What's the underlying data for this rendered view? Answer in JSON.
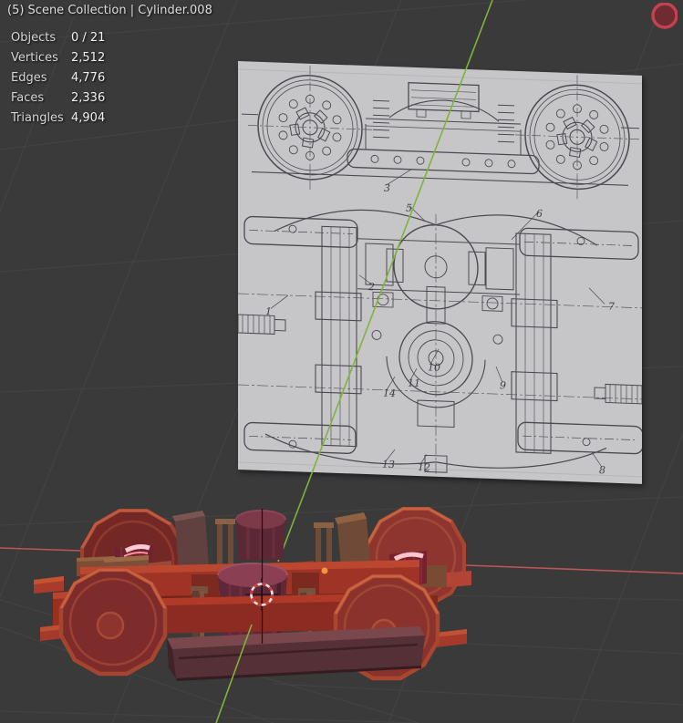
{
  "header": {
    "breadcrumb": "(5) Scene Collection | Cylinder.008"
  },
  "stats": {
    "rows": [
      {
        "label": "Objects",
        "value": "0 / 21"
      },
      {
        "label": "Vertices",
        "value": "2,512"
      },
      {
        "label": "Edges",
        "value": "4,776"
      },
      {
        "label": "Faces",
        "value": "2,336"
      },
      {
        "label": "Triangles",
        "value": "4,904"
      }
    ]
  },
  "viewport": {
    "background": "#3a3a3a",
    "grid_color": "#4c4c4c"
  },
  "axes": {
    "y_axis_color": "#7fb33a",
    "x_axis_color": "#bd5656"
  },
  "gizmo": {
    "x_ring_color": "#c4424d",
    "x_fill_color": "#6f2b33"
  },
  "cursor3d": {
    "ring_red": "#cc3b3b",
    "ring_white": "#e9e9e9",
    "cross_color": "#141414"
  },
  "origin_dot": {
    "color": "#f09440"
  },
  "materials": {
    "paper": "#c6c6c8",
    "ink": "#4a4a52",
    "wheel_face": "#7e2b2b",
    "wheel_rim": "#a4452f",
    "wheel_highlight": "#c85f3f",
    "frame_red": "#9e3326",
    "frame_red_bright": "#bc4731",
    "frame_red_dark": "#6e241d",
    "cylinder_body": "#5f2738",
    "cylinder_top": "#8a4052",
    "beam_brown": "#6f4a36",
    "beam_maroon": "#614140",
    "axle_gloss_highlight": "#ffccd4"
  },
  "blueprint": {
    "callouts": [
      "3",
      "5",
      "6",
      "1",
      "2",
      "7",
      "10",
      "11",
      "14",
      "9",
      "13",
      "12",
      "8"
    ]
  }
}
